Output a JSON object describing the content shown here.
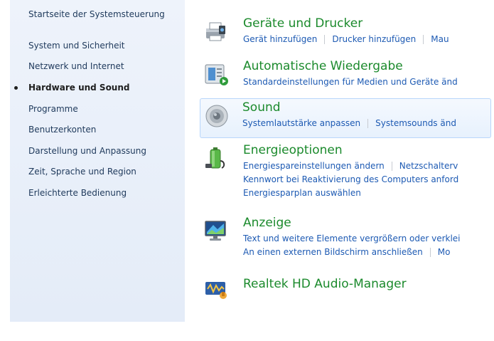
{
  "sidebar": {
    "home": "Startseite der Systemsteuerung",
    "items": [
      "System und Sicherheit",
      "Netzwerk und Internet",
      "Hardware und Sound",
      "Programme",
      "Benutzerkonten",
      "Darstellung und Anpassung",
      "Zeit, Sprache und Region",
      "Erleichterte Bedienung"
    ],
    "active_index": 2
  },
  "categories": [
    {
      "title": "Geräte und Drucker",
      "icon": "printer-icon",
      "lines": [
        [
          "Gerät hinzufügen",
          "Drucker hinzufügen",
          "Mau"
        ]
      ]
    },
    {
      "title": "Automatische Wiedergabe",
      "icon": "autoplay-icon",
      "lines": [
        [
          "Standardeinstellungen für Medien und Geräte änd"
        ]
      ]
    },
    {
      "title": "Sound",
      "icon": "speaker-icon",
      "lines": [
        [
          "Systemlautstärke anpassen",
          "Systemsounds änd"
        ]
      ]
    },
    {
      "title": "Energieoptionen",
      "icon": "battery-icon",
      "lines": [
        [
          "Energiespareinstellungen ändern",
          "Netzschalterv"
        ],
        [
          "Kennwort bei Reaktivierung des Computers anford"
        ],
        [
          "Energiesparplan auswählen"
        ]
      ]
    },
    {
      "title": "Anzeige",
      "icon": "display-icon",
      "lines": [
        [
          "Text und weitere Elemente vergrößern oder verklei"
        ],
        [
          "An einen externen Bildschirm anschließen",
          "Mo"
        ]
      ]
    },
    {
      "title": "Realtek HD Audio-Manager",
      "icon": "realtek-audio-icon",
      "lines": []
    }
  ],
  "colors": {
    "title_green": "#1b8a2c",
    "link_blue": "#1d5ab3",
    "nav_text": "#1e395b"
  }
}
